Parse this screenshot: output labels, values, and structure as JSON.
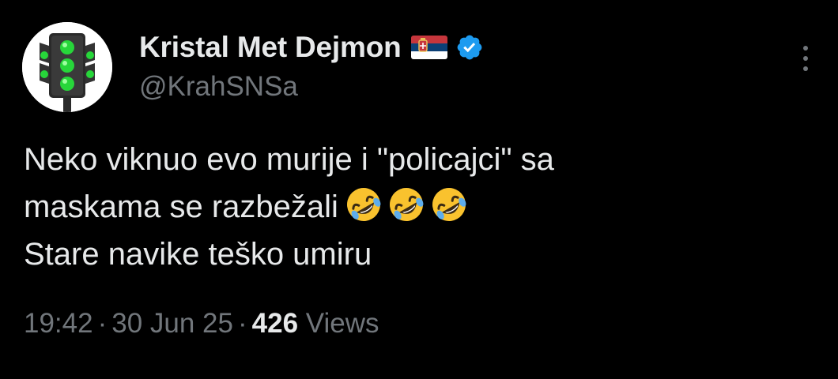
{
  "author": {
    "display_name": "Kristal Met Dejmon",
    "handle": "@KrahSNSa",
    "flag_icon": "serbia-flag-icon",
    "verified_icon": "verified-badge-icon",
    "verified_color": "#1d9bf0"
  },
  "tweet": {
    "line1": "Neko viknuo evo murije i \"policajci\" sa",
    "line2": "maskama se razbežali",
    "line3": "Stare navike teško umiru",
    "emoji_icon": "rolling-on-floor-laughing-icon",
    "emoji_count": 3
  },
  "meta": {
    "time": "19:42",
    "separator": "·",
    "date": "30 Jun 25",
    "views_count": "426",
    "views_label": "Views"
  },
  "colors": {
    "background": "#000000",
    "primary_text": "#e7e9ea",
    "secondary_text": "#71767b"
  }
}
